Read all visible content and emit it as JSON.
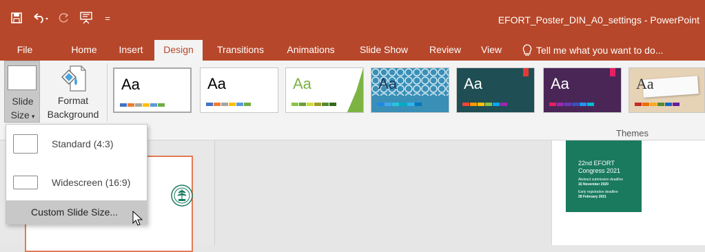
{
  "window": {
    "title": "EFORT_Poster_DIN_A0_settings - PowerPoint"
  },
  "quick_access": {
    "icons": [
      "save-icon",
      "undo-icon",
      "redo-icon",
      "start-from-beginning-icon",
      "customize-qat-icon"
    ],
    "customize_glyph": "="
  },
  "tabs": [
    {
      "label": "File"
    },
    {
      "label": "Home"
    },
    {
      "label": "Insert"
    },
    {
      "label": "Design"
    },
    {
      "label": "Transitions"
    },
    {
      "label": "Animations"
    },
    {
      "label": "Slide Show"
    },
    {
      "label": "Review"
    },
    {
      "label": "View"
    }
  ],
  "tell_me": {
    "text": "Tell me what you want to do...",
    "icon": "lightbulb-icon"
  },
  "ribbon": {
    "slide_size": {
      "line1": "Slide",
      "line2": "Size",
      "arrow": "▾"
    },
    "format_background": {
      "line1": "Format",
      "line2": "Background"
    },
    "themes_label": "Themes",
    "themes": [
      {
        "aa": "Aa",
        "bg": "#ffffff",
        "fg": "#000000",
        "colors": [
          "#4472c4",
          "#ed7d31",
          "#a5a5a5",
          "#ffc000",
          "#5b9bd5",
          "#70ad47"
        ]
      },
      {
        "aa": "Aa",
        "bg": "#ffffff",
        "fg": "#000000",
        "colors": [
          "#4472c4",
          "#ed7d31",
          "#a5a5a5",
          "#ffc000",
          "#5b9bd5",
          "#70ad47"
        ]
      },
      {
        "aa": "Aa",
        "bg": "#ffffff",
        "fg": "#7cb342",
        "colors": [
          "#8bc34a",
          "#689f38",
          "#cddc39",
          "#9e9d24",
          "#558b2f",
          "#33691e"
        ]
      },
      {
        "aa": "Aa",
        "bg": "#3a8fb7",
        "fg": "#1a3a5c",
        "colors": [
          "#1e88e5",
          "#42a5f5",
          "#26c6da",
          "#00acc1",
          "#29b6f6",
          "#0277bd"
        ]
      },
      {
        "aa": "Aa",
        "bg": "#1f4e54",
        "fg": "#ffffff",
        "colors": [
          "#f44336",
          "#ff9800",
          "#ffc107",
          "#8bc34a",
          "#03a9f4",
          "#9c27b0"
        ]
      },
      {
        "aa": "Aa",
        "bg": "#4a2657",
        "fg": "#ffffff",
        "colors": [
          "#e91e63",
          "#9c27b0",
          "#673ab7",
          "#3f51b5",
          "#2196f3",
          "#00bcd4"
        ]
      },
      {
        "aa": "Aa",
        "bg": "#e6d2b5",
        "fg": "#333333",
        "colors": [
          "#c62828",
          "#ef6c00",
          "#f9a825",
          "#558b2f",
          "#1565c0",
          "#6a1b9a"
        ]
      }
    ]
  },
  "dropdown": {
    "items": [
      {
        "label": "Standard (4:3)"
      },
      {
        "label": "Widescreen (16:9)"
      },
      {
        "label": "Custom Slide Size..."
      }
    ]
  },
  "slide": {
    "poster_title_line1": "22nd EFORT",
    "poster_title_line2": "Congress 2021",
    "abstract_line1": "Abstract submission deadline",
    "abstract_line2": "16 November 2020",
    "registration_line1": "Early registration deadline",
    "registration_line2": "28 February 2021"
  },
  "colors": {
    "accent": "#b7472a",
    "green": "#1a7a5e",
    "thumb_border": "#e07b54"
  }
}
